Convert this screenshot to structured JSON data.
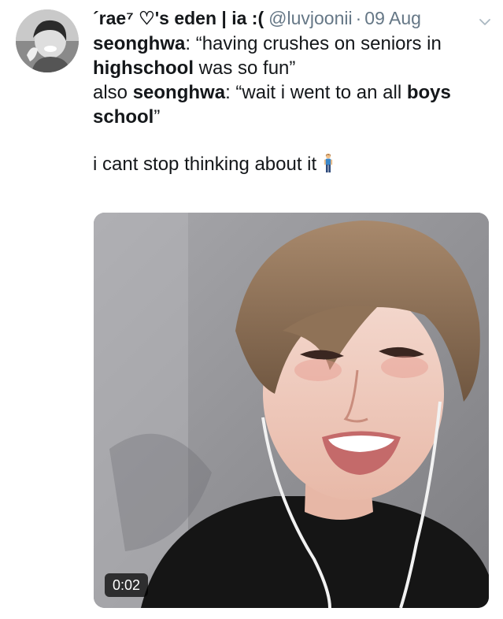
{
  "tweet": {
    "display_name": "´rae⁷ ♡'s eden | ia :(",
    "handle": "@luvjoonii",
    "separator": "·",
    "date": "09 Aug",
    "lines": [
      {
        "bold": "seonghwa",
        "text": ": “having crushes on seniors in"
      },
      {
        "bold": "highschool",
        "text": " was so fun”"
      },
      {
        "prefix": "also ",
        "bold": "seonghwa",
        "text": ": “wait i went to an all ",
        "bold2": "boys"
      },
      {
        "bold": "school",
        "text": "”"
      }
    ],
    "closing": "i cant stop thinking about it",
    "closing_icon": "person-standing-icon",
    "caret_icon": "chevron-down-icon"
  },
  "media": {
    "type": "video",
    "duration": "0:02"
  }
}
